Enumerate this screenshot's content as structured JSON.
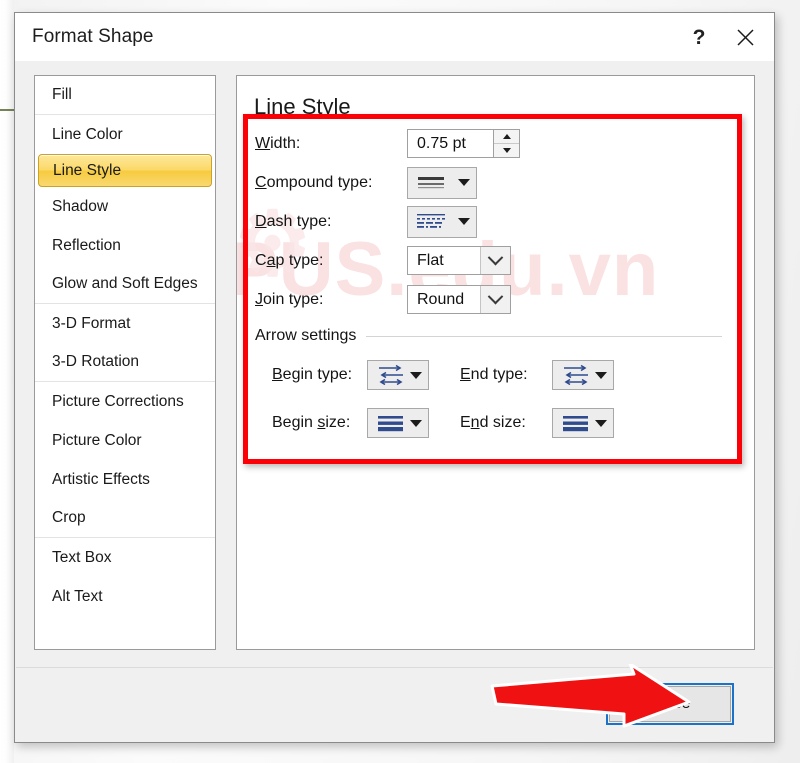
{
  "window": {
    "title": "Format Shape",
    "help_button": "?",
    "close_button_icon": "close-x-icon"
  },
  "sidebar": {
    "items": [
      {
        "label": "Fill",
        "selected": false,
        "separator_after": true
      },
      {
        "label": "Line Color",
        "selected": false,
        "separator_after": false
      },
      {
        "label": "Line Style",
        "selected": true,
        "separator_after": false
      },
      {
        "label": "Shadow",
        "selected": false,
        "separator_after": false
      },
      {
        "label": "Reflection",
        "selected": false,
        "separator_after": false
      },
      {
        "label": "Glow and Soft Edges",
        "selected": false,
        "separator_after": true
      },
      {
        "label": "3-D Format",
        "selected": false,
        "separator_after": false
      },
      {
        "label": "3-D Rotation",
        "selected": false,
        "separator_after": true
      },
      {
        "label": "Picture Corrections",
        "selected": false,
        "separator_after": false
      },
      {
        "label": "Picture Color",
        "selected": false,
        "separator_after": false
      },
      {
        "label": "Artistic Effects",
        "selected": false,
        "separator_after": false
      },
      {
        "label": "Crop",
        "selected": false,
        "separator_after": true
      },
      {
        "label": "Text Box",
        "selected": false,
        "separator_after": false
      },
      {
        "label": "Alt Text",
        "selected": false,
        "separator_after": false
      }
    ]
  },
  "pane": {
    "title": "Line Style",
    "width": {
      "label_pre": "",
      "label_accel": "W",
      "label_post": "idth:",
      "value": "0.75 pt",
      "spin_up_icon": "triangle-up-icon",
      "spin_down_icon": "triangle-down-icon"
    },
    "compound_type": {
      "label_accel": "C",
      "label_post": "ompound type:",
      "icon": "compound-line-thick-thin-icon",
      "dropdown_icon": "dropdown-arrow-icon"
    },
    "dash_type": {
      "label_accel": "D",
      "label_post": "ash type:",
      "icon": "dash-pattern-icon",
      "dropdown_icon": "dropdown-arrow-icon"
    },
    "cap_type": {
      "label_accel": "C",
      "label_mid": "a",
      "label_accel2": "p",
      "label_post": " type:",
      "value": "Flat",
      "dropdown_icon": "chevron-down-icon"
    },
    "join_type": {
      "label_accel": "J",
      "label_post": "oin type:",
      "value": "Round",
      "dropdown_icon": "chevron-down-icon"
    },
    "arrow_settings": {
      "group_label": "Arrow settings",
      "begin_type": {
        "label_accel": "B",
        "label_post": "egin type:",
        "icon": "arrow-style-gallery-icon",
        "dropdown_icon": "dropdown-arrow-icon"
      },
      "end_type": {
        "label_accel": "E",
        "label_post": "nd type:",
        "icon": "arrow-style-gallery-icon",
        "dropdown_icon": "dropdown-arrow-icon"
      },
      "begin_size": {
        "label_pre": "Begin ",
        "label_accel": "s",
        "label_post": "ize:",
        "icon": "arrow-size-gallery-icon",
        "dropdown_icon": "dropdown-arrow-icon"
      },
      "end_size": {
        "label_pre": "E",
        "label_accel": "n",
        "label_post": "d size:",
        "icon": "arrow-size-gallery-icon",
        "dropdown_icon": "dropdown-arrow-icon"
      }
    }
  },
  "footer": {
    "close_label": "Close"
  },
  "annotations": {
    "highlight_box_color": "#FB0007",
    "pointer_arrow_color": "#F01212",
    "pointer_arrow_name": "red-annotation-arrow",
    "highlight_box_name": "red-annotation-box"
  },
  "watermark": {
    "text": "PUS.edu.vn",
    "color": "#F6C9CB"
  }
}
